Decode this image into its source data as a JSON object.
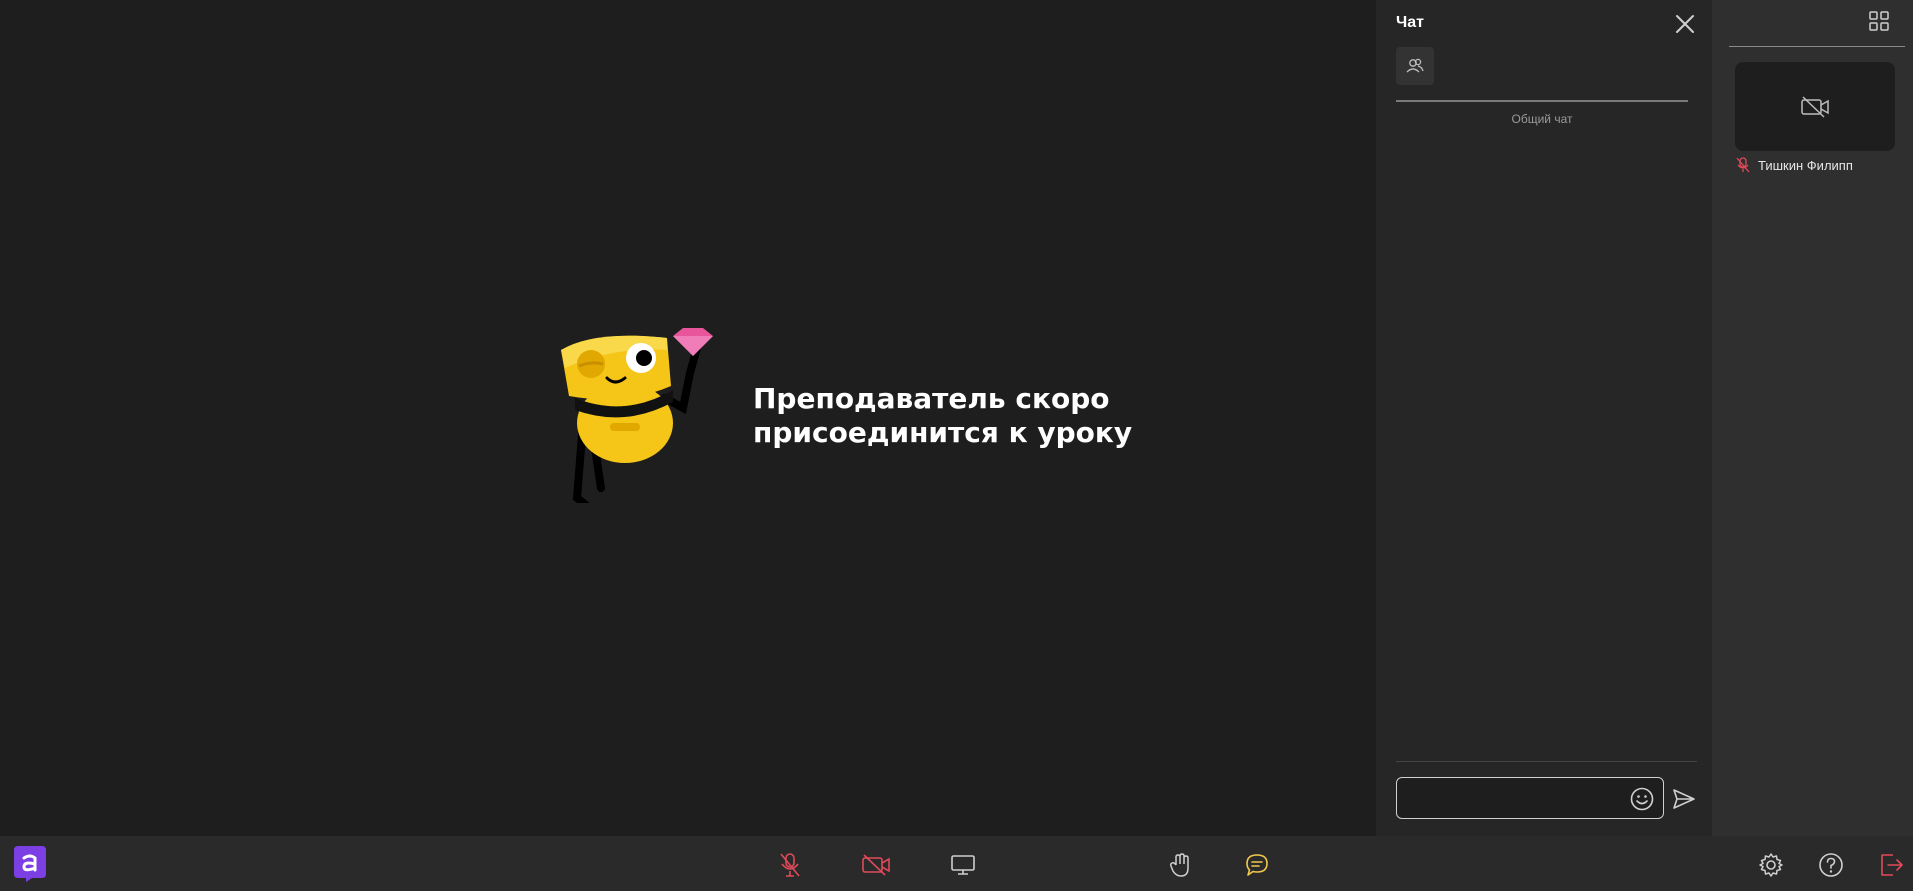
{
  "stage": {
    "waiting_message": "Преподаватель скоро присоединится к уроку"
  },
  "chat": {
    "title": "Чат",
    "channel_label": "Общий чат",
    "input_value": "",
    "input_placeholder": ""
  },
  "participants": [
    {
      "name": "Тишкин Филипп",
      "mic": "muted",
      "camera": "off"
    }
  ],
  "toolbar": {
    "icons": [
      "logo-icon",
      "microphone-muted-icon",
      "camera-off-icon",
      "screen-share-icon",
      "raise-hand-icon",
      "chat-icon",
      "settings-icon",
      "help-icon",
      "exit-icon"
    ]
  },
  "colors": {
    "background": "#1e1e1e",
    "chat_panel": "#262626",
    "participants_panel": "#2f2f2f",
    "toolbar": "#2a2a2a",
    "muted_red": "#e04a5a",
    "chat_active_yellow": "#f2c94c",
    "brand_purple": "#7b3fe4",
    "mascot_yellow": "#f5c518"
  }
}
